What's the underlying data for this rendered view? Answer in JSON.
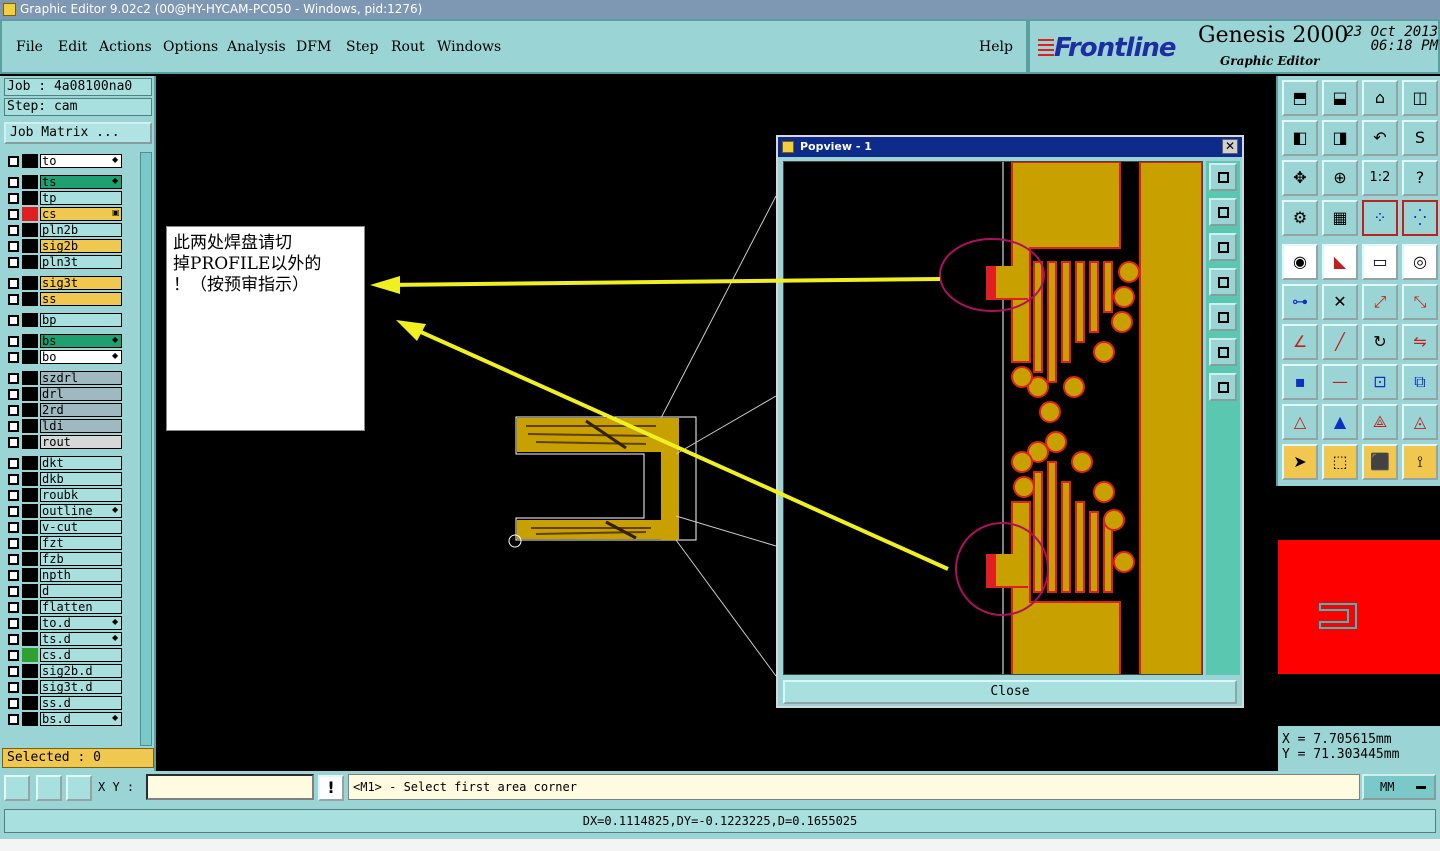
{
  "window": {
    "title": "Graphic Editor 9.02c2 (00@HY-HYCAM-PC050 - Windows, pid:1276)"
  },
  "menu": {
    "file": "File",
    "edit": "Edit",
    "actions": "Actions",
    "options": "Options",
    "analysis": "Analysis",
    "dfm": "DFM",
    "step": "Step",
    "rout": "Rout",
    "windows": "Windows",
    "help": "Help"
  },
  "brand": {
    "logo": "Frontline",
    "product": "Genesis 2000",
    "subtitle": "Graphic Editor",
    "date": "23 Oct 2013",
    "time": "06:18 PM"
  },
  "job": {
    "job_line": "Job : 4a08100na0",
    "step_line": "Step: cam",
    "matrix_button": "Job Matrix ..."
  },
  "layers": [
    {
      "name": "to",
      "color": "#ffffff",
      "swatch": "#000000",
      "mark": "◆"
    },
    {
      "name": "ts",
      "color": "#20a070",
      "swatch": "#000000",
      "mark": "◆"
    },
    {
      "name": "tp",
      "color": "#a8e0e0",
      "swatch": "#000000",
      "mark": ""
    },
    {
      "name": "cs",
      "color": "#f0c850",
      "swatch": "#e02020",
      "mark": "▣"
    },
    {
      "name": "pln2b",
      "color": "#a8e0e0",
      "swatch": "#000000",
      "mark": ""
    },
    {
      "name": "sig2b",
      "color": "#f0c850",
      "swatch": "#000000",
      "mark": ""
    },
    {
      "name": "pln3t",
      "color": "#a8e0e0",
      "swatch": "#000000",
      "mark": ""
    },
    {
      "name": "sig3t",
      "color": "#f0c850",
      "swatch": "#000000",
      "mark": ""
    },
    {
      "name": "ss",
      "color": "#f0c850",
      "swatch": "#000000",
      "mark": ""
    },
    {
      "name": "bp",
      "color": "#a8e0e0",
      "swatch": "#000000",
      "mark": ""
    },
    {
      "name": "bs",
      "color": "#20a070",
      "swatch": "#000000",
      "mark": "◆"
    },
    {
      "name": "bo",
      "color": "#ffffff",
      "swatch": "#000000",
      "mark": "◆"
    },
    {
      "name": "szdrl",
      "color": "#a0b8c0",
      "swatch": "#000000",
      "mark": ""
    },
    {
      "name": "drl",
      "color": "#a0b8c0",
      "swatch": "#000000",
      "mark": ""
    },
    {
      "name": "2rd",
      "color": "#a0b8c0",
      "swatch": "#000000",
      "mark": ""
    },
    {
      "name": "ldi",
      "color": "#a0b8c0",
      "swatch": "#000000",
      "mark": ""
    },
    {
      "name": "rout",
      "color": "#d8d8d8",
      "swatch": "#000000",
      "mark": ""
    },
    {
      "name": "dkt",
      "color": "#a8e0e0",
      "swatch": "#000000",
      "mark": ""
    },
    {
      "name": "dkb",
      "color": "#a8e0e0",
      "swatch": "#000000",
      "mark": ""
    },
    {
      "name": "roubk",
      "color": "#a8e0e0",
      "swatch": "#000000",
      "mark": ""
    },
    {
      "name": "outline",
      "color": "#a8e0e0",
      "swatch": "#000000",
      "mark": "◆"
    },
    {
      "name": "v-cut",
      "color": "#a8e0e0",
      "swatch": "#000000",
      "mark": ""
    },
    {
      "name": "fzt",
      "color": "#a8e0e0",
      "swatch": "#000000",
      "mark": ""
    },
    {
      "name": "fzb",
      "color": "#a8e0e0",
      "swatch": "#000000",
      "mark": ""
    },
    {
      "name": "npth",
      "color": "#a8e0e0",
      "swatch": "#000000",
      "mark": ""
    },
    {
      "name": "d",
      "color": "#a8e0e0",
      "swatch": "#000000",
      "mark": ""
    },
    {
      "name": "flatten",
      "color": "#a8e0e0",
      "swatch": "#000000",
      "mark": ""
    },
    {
      "name": "to.d",
      "color": "#a8e0e0",
      "swatch": "#000000",
      "mark": "◆"
    },
    {
      "name": "ts.d",
      "color": "#a8e0e0",
      "swatch": "#000000",
      "mark": "◆"
    },
    {
      "name": "cs.d",
      "color": "#a8e0e0",
      "swatch": "#30a030",
      "mark": ""
    },
    {
      "name": "sig2b.d",
      "color": "#a8e0e0",
      "swatch": "#000000",
      "mark": ""
    },
    {
      "name": "sig3t.d",
      "color": "#a8e0e0",
      "swatch": "#000000",
      "mark": ""
    },
    {
      "name": "ss.d",
      "color": "#a8e0e0",
      "swatch": "#000000",
      "mark": ""
    },
    {
      "name": "bs.d",
      "color": "#a8e0e0",
      "swatch": "#000000",
      "mark": "◆"
    }
  ],
  "selected": "Selected : 0",
  "note": {
    "line1": "此两处焊盘请切",
    "line2": "掉PROFILE以外的",
    "line3": "！（按预审指示）"
  },
  "popview": {
    "title": "Popview - 1",
    "close_x": "✕",
    "close_button": "Close"
  },
  "coords": {
    "x": "X = 7.705615mm",
    "y": "Y = 71.303445mm"
  },
  "bottom": {
    "xy_label": "X Y :",
    "xy_value": "",
    "message": "<M1> - Select first area corner",
    "units": "MM",
    "status": "DX=0.1114825,DY=-0.1223225,D=0.1655025"
  },
  "colors": {
    "panel": "#9ad4d4",
    "copper": "#c8a000",
    "pad_red": "#e02020",
    "arrow": "#f0f020",
    "circle": "#b01060"
  }
}
